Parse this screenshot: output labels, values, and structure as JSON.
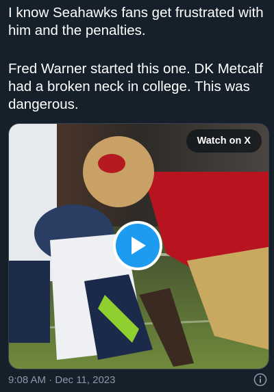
{
  "tweet": {
    "paragraphs": [
      "I know Seahawks fans get frustrated with him and the penalties.",
      "Fred Warner started this one. DK Metcalf had a broken neck in college. This was dangerous."
    ],
    "timestamp": "9:08 AM · Dec 11, 2023"
  },
  "media": {
    "watch_label": "Watch on X",
    "play_icon": "play-icon",
    "accent_color": "#1d9bf0"
  },
  "footer": {
    "info_icon": "info-icon"
  }
}
